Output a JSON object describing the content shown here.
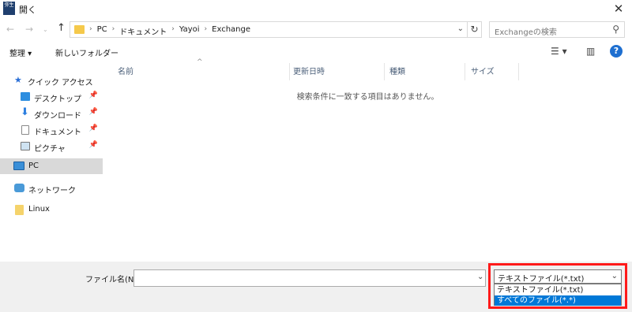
{
  "window": {
    "title": "開く",
    "app_icon_text": "弥生"
  },
  "address": {
    "crumbs": [
      "PC",
      "ドキュメント",
      "Yayoi",
      "Exchange"
    ]
  },
  "search": {
    "placeholder": "Exchangeの検索"
  },
  "toolbar": {
    "organize_label": "整理 ▾",
    "new_folder_label": "新しいフォルダー"
  },
  "nav": {
    "items": [
      {
        "label": "クイック アクセス",
        "icon": "star-icon",
        "pinned": false
      },
      {
        "label": "デスクトップ",
        "icon": "desktop-icon",
        "pinned": true
      },
      {
        "label": "ダウンロード",
        "icon": "download-arrow-icon",
        "pinned": true
      },
      {
        "label": "ドキュメント",
        "icon": "document-icon",
        "pinned": true
      },
      {
        "label": "ピクチャ",
        "icon": "picture-icon",
        "pinned": true
      },
      {
        "label": "PC",
        "icon": "computer-icon",
        "selected": true
      },
      {
        "label": "ネットワーク",
        "icon": "network-icon"
      },
      {
        "label": "Linux",
        "icon": "folder-icon"
      }
    ]
  },
  "columns": [
    "名前",
    "更新日時",
    "種類",
    "サイズ"
  ],
  "empty_message": "検索条件に一致する項目はありません。",
  "bottom": {
    "filename_label": "ファイル名(N):",
    "filename_value": "",
    "filetype_selected": "テキストファイル(*.txt)",
    "filetype_options": [
      "テキストファイル(*.txt)",
      "すべてのファイル(*.*)"
    ],
    "highlighted_option_index": 1
  },
  "colors": {
    "selection": "#0078d7",
    "highlight_frame": "#ff1a1a",
    "folder": "#f5c94b",
    "help": "#1e6fd0"
  }
}
